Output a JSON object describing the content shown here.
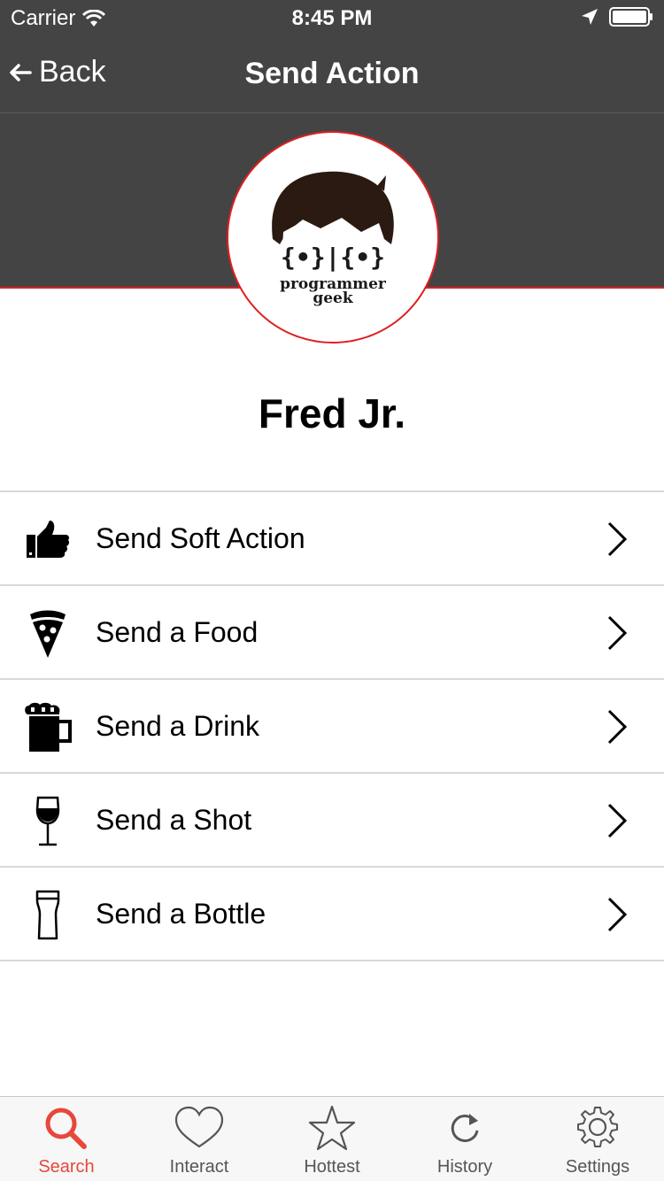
{
  "status_bar": {
    "carrier": "Carrier",
    "time": "8:45 PM"
  },
  "nav": {
    "back_label": "Back",
    "title": "Send Action"
  },
  "profile": {
    "name": "Fred Jr.",
    "avatar_logo_text": "programmer geek",
    "accent_color": "#e01f1f"
  },
  "actions": [
    {
      "label": "Send Soft Action",
      "icon": "thumbs-up-icon"
    },
    {
      "label": "Send a Food",
      "icon": "pizza-icon"
    },
    {
      "label": "Send a Drink",
      "icon": "beer-mug-icon"
    },
    {
      "label": "Send a Shot",
      "icon": "wine-glass-icon"
    },
    {
      "label": "Send a Bottle",
      "icon": "pint-glass-icon"
    }
  ],
  "tabs": [
    {
      "label": "Search",
      "icon": "search-icon",
      "active": true
    },
    {
      "label": "Interact",
      "icon": "heart-icon",
      "active": false
    },
    {
      "label": "Hottest",
      "icon": "star-icon",
      "active": false
    },
    {
      "label": "History",
      "icon": "refresh-icon",
      "active": false
    },
    {
      "label": "Settings",
      "icon": "gear-icon",
      "active": false
    }
  ],
  "colors": {
    "bar_background": "#444444",
    "active_tab": "#e8473b",
    "divider": "#d9d9d9"
  }
}
